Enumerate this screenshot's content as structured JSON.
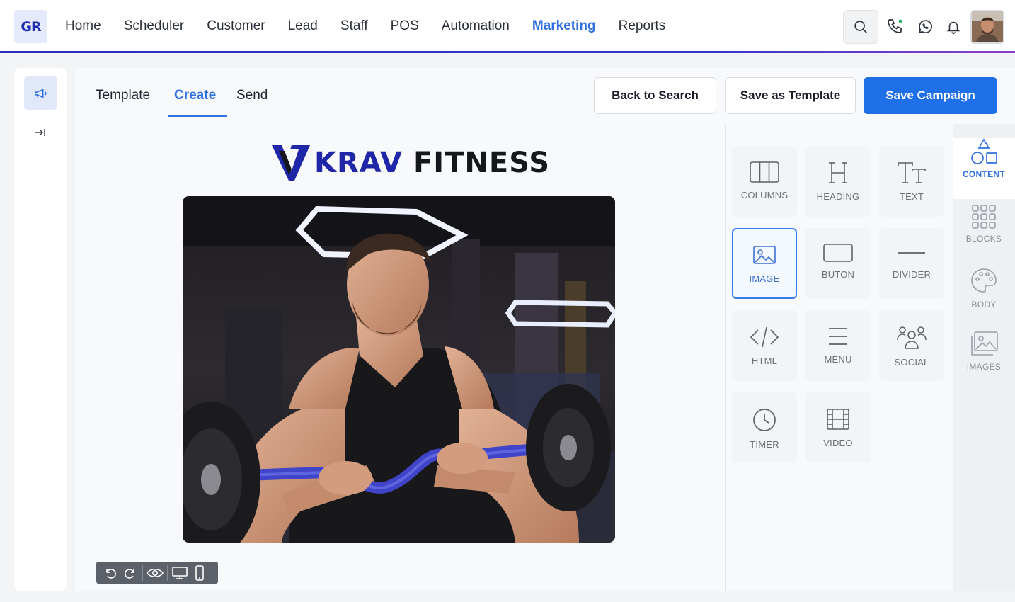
{
  "app": {
    "logo_text": "GR"
  },
  "nav": {
    "items": [
      {
        "label": "Home",
        "active": false
      },
      {
        "label": "Scheduler",
        "active": false
      },
      {
        "label": "Customer",
        "active": false
      },
      {
        "label": "Lead",
        "active": false
      },
      {
        "label": "Staff",
        "active": false
      },
      {
        "label": "POS",
        "active": false
      },
      {
        "label": "Automation",
        "active": false
      },
      {
        "label": "Marketing",
        "active": true
      },
      {
        "label": "Reports",
        "active": false
      }
    ],
    "icons": [
      "search-icon",
      "phone-icon",
      "whatsapp-icon",
      "bell-icon"
    ],
    "accent": "#2f6fe0"
  },
  "editor": {
    "tabs": [
      {
        "label": "Template",
        "active": false
      },
      {
        "label": "Create",
        "active": true
      },
      {
        "label": "Send",
        "active": false
      }
    ],
    "buttons": {
      "back": "Back to Search",
      "save_template": "Save as Template",
      "save_campaign": "Save Campaign"
    },
    "primary_color": "#1f6fe8"
  },
  "canvas": {
    "brand_k": "KRAV",
    "brand_f": "FITNESS",
    "brand_color": "#2026a8"
  },
  "content_tools": [
    {
      "label": "COLUMNS",
      "icon": "columns-icon",
      "active": false
    },
    {
      "label": "HEADING",
      "icon": "heading-icon",
      "active": false
    },
    {
      "label": "TEXT",
      "icon": "text-icon",
      "active": false
    },
    {
      "label": "IMAGE",
      "icon": "image-icon",
      "active": true
    },
    {
      "label": "BUTON",
      "icon": "button-icon",
      "active": false
    },
    {
      "label": "DIVIDER",
      "icon": "divider-icon",
      "active": false
    },
    {
      "label": "HTML",
      "icon": "code-icon",
      "active": false
    },
    {
      "label": "MENU",
      "icon": "menu-icon",
      "active": false
    },
    {
      "label": "SOCIAL",
      "icon": "users-icon",
      "active": false
    },
    {
      "label": "TIMER",
      "icon": "clock-icon",
      "active": false
    },
    {
      "label": "VIDEO",
      "icon": "film-icon",
      "active": false
    }
  ],
  "side_tabs": [
    {
      "label": "CONTENT",
      "icon": "shapes-icon",
      "active": true
    },
    {
      "label": "BLOCKS",
      "icon": "grid-icon",
      "active": false
    },
    {
      "label": "BODY",
      "icon": "palette-icon",
      "active": false
    },
    {
      "label": "IMAGES",
      "icon": "images-icon",
      "active": false
    }
  ]
}
